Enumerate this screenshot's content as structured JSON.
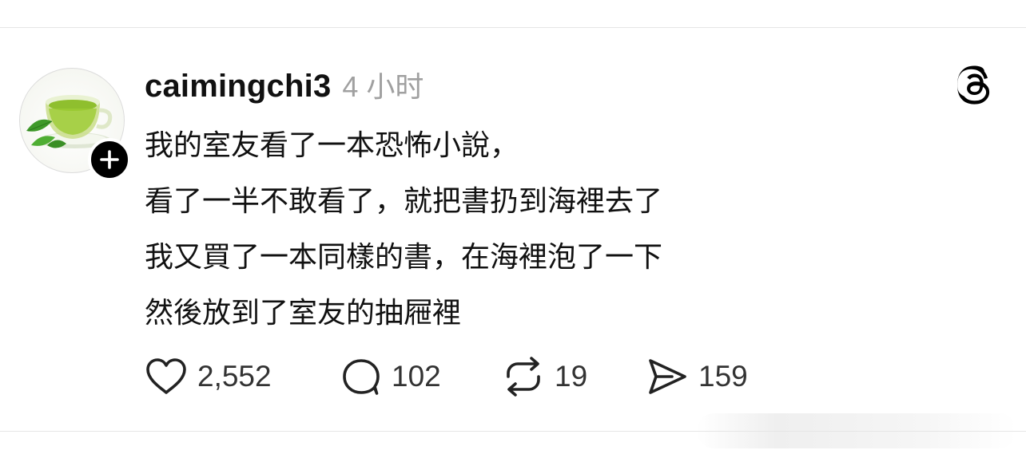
{
  "post": {
    "username": "caimingchi3",
    "timestamp": "4 小时",
    "lines": [
      "我的室友看了一本恐怖小說，",
      "看了一半不敢看了，就把書扔到海裡去了",
      "我又買了一本同樣的書，在海裡泡了一下",
      "然後放到了室友的抽屜裡"
    ]
  },
  "stats": {
    "likes": "2,552",
    "replies": "102",
    "reposts": "19",
    "shares": "159"
  },
  "icons": {
    "avatar": "green-tea-cup-image",
    "follow": "plus-icon",
    "brand": "threads-logo-icon",
    "like": "heart-icon",
    "reply": "speech-bubble-icon",
    "repost": "repost-arrows-icon",
    "share": "send-icon"
  },
  "colors": {
    "text": "#111111",
    "muted": "#a0a0a0",
    "badge": "#000000"
  }
}
